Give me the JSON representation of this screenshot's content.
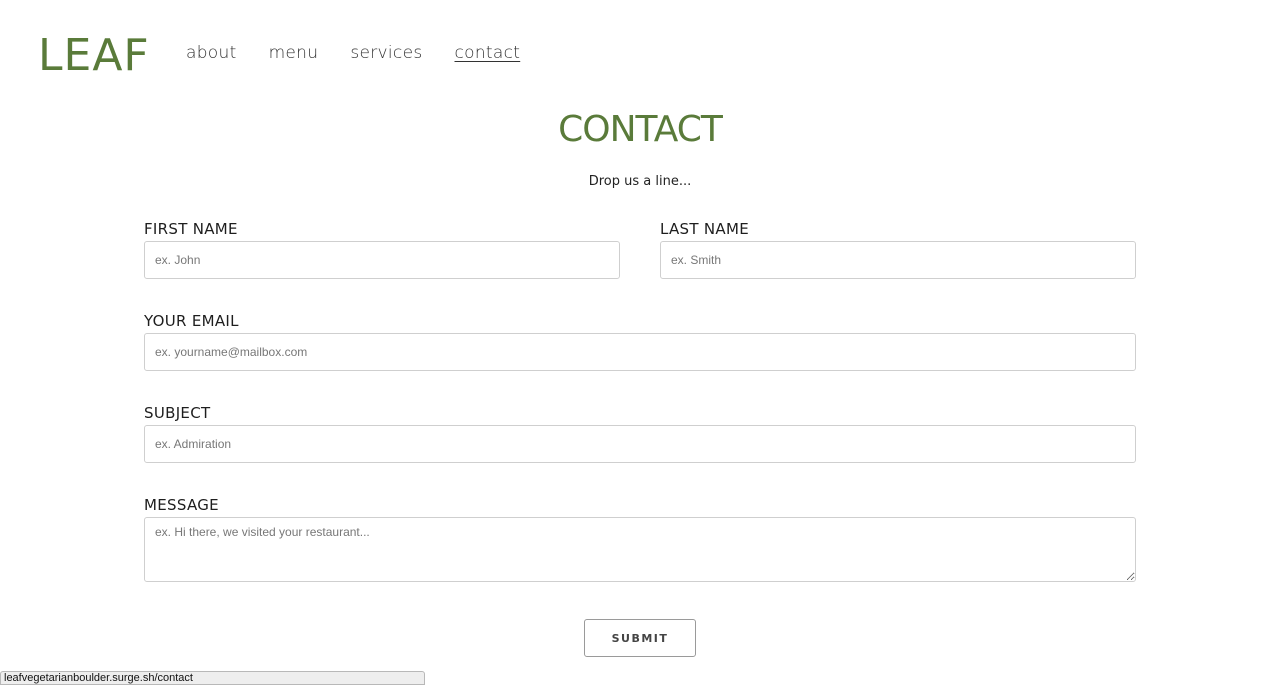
{
  "header": {
    "logo": "LEAF",
    "nav": [
      {
        "label": "about"
      },
      {
        "label": "menu"
      },
      {
        "label": "services"
      },
      {
        "label": "contact",
        "active": true
      }
    ]
  },
  "main": {
    "title": "CONTACT",
    "subtitle": "Drop us a line...",
    "form": {
      "first_name": {
        "label": "FIRST NAME",
        "placeholder": "ex. John",
        "value": ""
      },
      "last_name": {
        "label": "LAST NAME",
        "placeholder": "ex. Smith",
        "value": ""
      },
      "email": {
        "label": "YOUR EMAIL",
        "placeholder": "ex. yourname@mailbox.com",
        "value": ""
      },
      "subject": {
        "label": "SUBJECT",
        "placeholder": "ex. Admiration",
        "value": ""
      },
      "message": {
        "label": "MESSAGE",
        "placeholder": "ex. Hi there, we visited your restaurant...",
        "value": ""
      },
      "submit_label": "SUBMIT"
    }
  },
  "status_bar": {
    "url": "leafvegetarianboulder.surge.sh/contact"
  },
  "colors": {
    "brand_green": "#5a7b3a",
    "text": "#222222",
    "border": "#cfcfcf"
  }
}
